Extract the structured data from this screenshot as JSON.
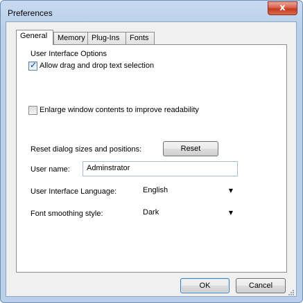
{
  "window": {
    "title": "Preferences",
    "close_glyph": "x"
  },
  "tabs": [
    {
      "label": "General",
      "active": true
    },
    {
      "label": "Memory",
      "active": false
    },
    {
      "label": "Plug-Ins",
      "active": false
    },
    {
      "label": "Fonts",
      "active": false
    }
  ],
  "general": {
    "group_label": "User Interface Options",
    "drag_drop": {
      "label": "Allow drag and drop text selection",
      "checked": true
    },
    "enlarge": {
      "label": "Enlarge window contents to improve readability",
      "checked": false
    },
    "reset_label": "Reset dialog sizes and positions:",
    "reset_button": "Reset",
    "user_name_label": "User name:",
    "user_name_value": "Adminstrator",
    "ui_language_label": "User Interface Language:",
    "ui_language_value": "English",
    "font_smoothing_label": "Font smoothing style:",
    "font_smoothing_value": "Dark"
  },
  "footer": {
    "ok_label": "OK",
    "cancel_label": "Cancel"
  },
  "icons": {
    "dropdown": "chevron-down-icon",
    "close": "close-icon",
    "checkmark": "checkmark-icon"
  }
}
